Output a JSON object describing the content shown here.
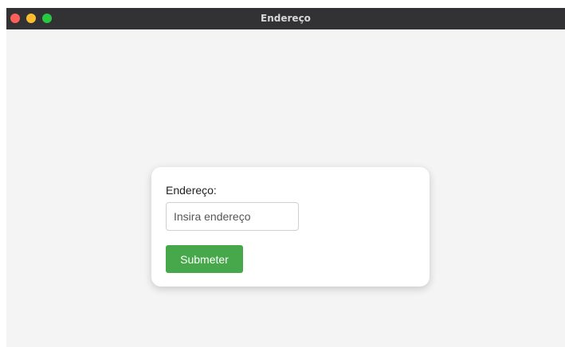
{
  "window": {
    "title": "Endereço",
    "controls": [
      "close",
      "minimize",
      "zoom"
    ],
    "colors": {
      "close": "#fe5f57",
      "minimize": "#febc2e",
      "zoom": "#28c840",
      "titlebar": "#323235",
      "background": "#f4f4f4"
    }
  },
  "form": {
    "label": "Endereço:",
    "address_value": "",
    "address_placeholder": "Insira endereço",
    "submit_label": "Submeter",
    "submit_color": "#46a84a"
  }
}
